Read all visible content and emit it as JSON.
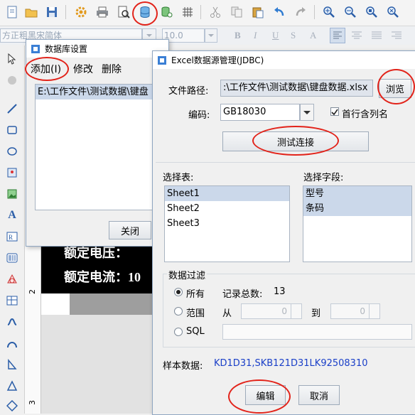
{
  "format_bar": {
    "font_name": "方正粗黑宋简体",
    "font_size": "10.0",
    "bold": "B",
    "italic": "I",
    "underline": "U",
    "strike": "S",
    "more": "A"
  },
  "canvas": {
    "text_line1": "额定电压：",
    "text_line2": "额定电流：10",
    "ruler_mark_2": "2",
    "ruler_mark_3": "3"
  },
  "db_settings_dialog": {
    "title": "数据库设置",
    "menu_add": "添加(I)",
    "menu_edit": "修改",
    "menu_delete": "删除",
    "list_items": [
      "E:\\工作文件\\测试数据\\键盘"
    ],
    "close_button": "关闭"
  },
  "excel_dialog": {
    "title": "Excel数据源管理(JDBC)",
    "file_path_label": "文件路径:",
    "file_path_value": ":\\工作文件\\测试数据\\键盘数据.xlsx",
    "browse_button": "浏览",
    "encoding_label": "编码:",
    "encoding_value": "GB18030",
    "first_row_header_label": "首行含列名",
    "first_row_header_checked": true,
    "test_connection_button": "测试连接",
    "select_table_label": "选择表:",
    "tables": [
      "Sheet1",
      "Sheet2",
      "Sheet3"
    ],
    "select_field_label": "选择字段:",
    "fields": [
      "型号",
      "条码"
    ],
    "filter_label": "数据过滤",
    "filter_all_label": "所有",
    "record_count_label": "记录总数:",
    "record_count_value": "13",
    "filter_range_label": "范围",
    "range_from_label": "从",
    "range_to_label": "到",
    "range_from_value": "0",
    "range_to_value": "0",
    "filter_sql_label": "SQL",
    "sample_label": "样本数据:",
    "sample_value": "KD1D31,SKB121D31LK92508310",
    "edit_button": "编辑",
    "cancel_button": "取消"
  },
  "colors": {
    "highlight_ring": "#e2231a",
    "sample_text": "#1a3fc8",
    "selection": "#cbd8ea"
  }
}
